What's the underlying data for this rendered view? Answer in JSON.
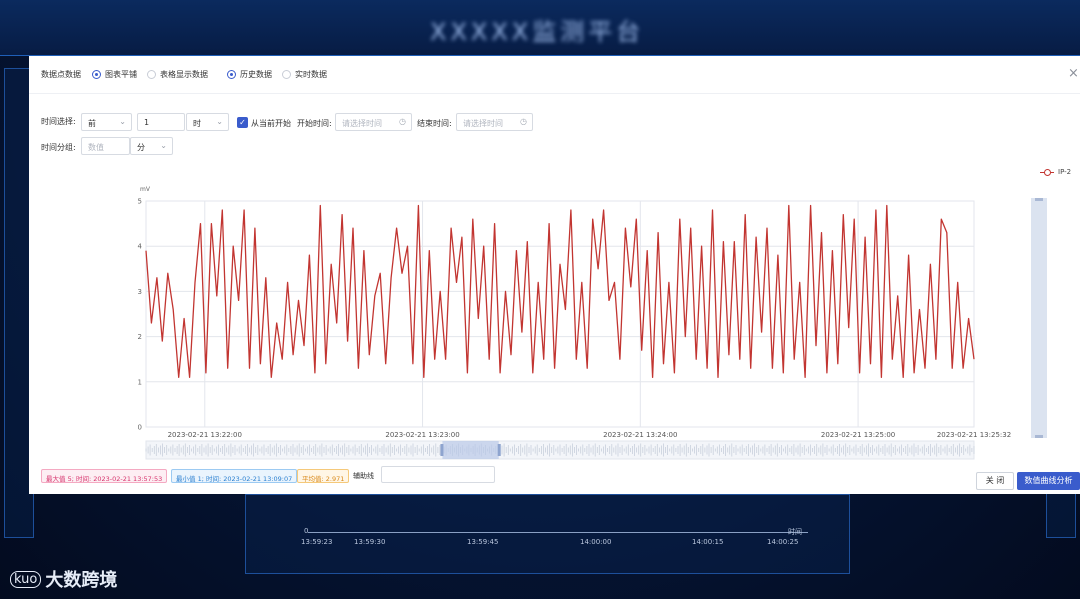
{
  "background": {
    "title": "XXXXX监测平台",
    "axis_label": "时间",
    "axis_zero": "0",
    "axis_times": [
      "13:59:23",
      "13:59:30",
      "13:59:45",
      "14:00:00",
      "14:00:15",
      "14:00:25"
    ]
  },
  "watermark": {
    "logo": "kuo",
    "text": "大数跨境"
  },
  "modal": {
    "header": {
      "label": "数据点数据",
      "radio_chart": "图表平铺",
      "radio_table": "表格显示数据",
      "radio_history": "历史数据",
      "radio_realtime": "实时数据",
      "close_glyph": "×"
    },
    "filters": {
      "time_select_label": "时间选择:",
      "direction_value": "前",
      "amount_value": "1",
      "unit_value": "时",
      "from_now_label": "从当前开始",
      "start_label": "开始时间:",
      "start_placeholder": "请选择时间",
      "end_label": "结束时间:",
      "end_placeholder": "请选择时间",
      "group_label": "时间分组:",
      "group_placeholder": "数值",
      "group_unit": "分"
    },
    "stats": {
      "max": "最大值 5; 时间: 2023-02-21 13:57:53",
      "min": "最小值 1; 时间: 2023-02-21 13:09:07",
      "avg": "平均值: 2.971"
    },
    "aux_label": "辅助线",
    "buttons": {
      "close": "关 闭",
      "analyze": "数值曲线分析"
    }
  },
  "chart_data": {
    "type": "line",
    "ylabel": "mV",
    "ylim": [
      0,
      5
    ],
    "y_ticks": [
      0,
      1,
      2,
      3,
      4,
      5
    ],
    "x_tick_labels": [
      "2023-02-21 13:22:00",
      "2023-02-21 13:23:00",
      "2023-02-21 13:24:00",
      "2023-02-21 13:25:00",
      "2023-02-21 13:25:32"
    ],
    "legend_position": "top-right",
    "grid": true,
    "series": [
      {
        "name": "IP-2",
        "color": "#c23531",
        "values": [
          3.9,
          2.3,
          3.3,
          1.9,
          3.4,
          2.6,
          1.1,
          2.4,
          1.1,
          3.2,
          4.5,
          1.2,
          4.5,
          2.9,
          4.8,
          1.3,
          4.0,
          2.8,
          4.8,
          1.3,
          4.4,
          1.4,
          3.3,
          1.1,
          2.3,
          1.5,
          3.2,
          1.6,
          2.8,
          1.8,
          3.8,
          1.2,
          4.9,
          1.4,
          3.6,
          2.3,
          4.7,
          1.9,
          4.4,
          1.3,
          3.9,
          1.6,
          2.9,
          3.4,
          1.4,
          3.3,
          4.4,
          3.4,
          4.0,
          1.4,
          4.9,
          1.1,
          3.9,
          1.5,
          3.0,
          1.5,
          4.4,
          3.2,
          4.2,
          1.2,
          4.6,
          2.4,
          4.0,
          1.5,
          4.5,
          1.2,
          3.0,
          1.6,
          3.9,
          2.1,
          4.1,
          1.2,
          3.2,
          1.5,
          4.5,
          1.3,
          3.6,
          2.6,
          4.8,
          1.5,
          3.2,
          1.3,
          4.6,
          3.5,
          4.8,
          2.8,
          3.2,
          1.5,
          4.4,
          3.1,
          4.6,
          1.7,
          3.9,
          1.1,
          4.3,
          1.4,
          3.2,
          1.2,
          4.6,
          2.0,
          4.4,
          1.5,
          4.0,
          1.3,
          4.8,
          1.1,
          4.1,
          1.6,
          4.1,
          1.5,
          4.7,
          1.3,
          4.2,
          2.1,
          4.4,
          1.3,
          3.8,
          1.2,
          4.9,
          1.5,
          3.2,
          1.1,
          4.9,
          1.8,
          4.3,
          1.2,
          3.9,
          1.4,
          4.7,
          2.2,
          4.6,
          1.2,
          4.2,
          1.4,
          4.8,
          1.1,
          4.9,
          1.5,
          2.9,
          1.1,
          3.8,
          1.2,
          2.6,
          1.3,
          3.6,
          1.5,
          4.6,
          4.3,
          1.3,
          3.2,
          1.3,
          2.4,
          1.5
        ]
      }
    ]
  }
}
